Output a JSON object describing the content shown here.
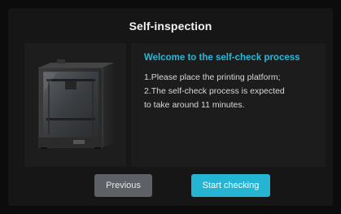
{
  "dialog": {
    "title": "Self-inspection"
  },
  "info": {
    "heading": "Welcome to the self-check process",
    "lines": [
      "1.Please place the printing platform;",
      "2.The self-check process is expected",
      "to take around 11 minutes."
    ]
  },
  "buttons": {
    "previous_label": "Previous",
    "start_label": "Start checking"
  },
  "colors": {
    "accent": "#26b4d3",
    "heading": "#27b8d8",
    "secondary_button": "#5d6166",
    "panel": "#161616"
  },
  "icons": {
    "printer": "3d-printer-image"
  }
}
